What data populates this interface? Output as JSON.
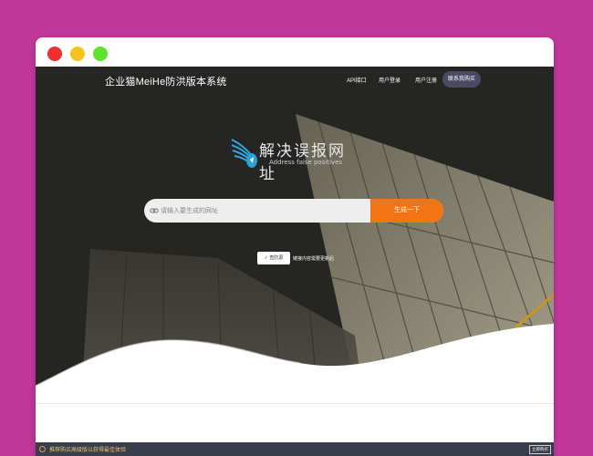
{
  "window": {
    "controls": [
      "close",
      "minimize",
      "maximize"
    ]
  },
  "header": {
    "brand": "企业猫MeiHe防洪版本系统",
    "nav": {
      "api": "API接口",
      "login": "用户登录",
      "register": "用户注册",
      "contact": "联系我购买"
    }
  },
  "logo": {
    "title": "解决误报网址",
    "subtitle": "Address false positives"
  },
  "search": {
    "placeholder": "请输入要生成的网址",
    "icon": "link-icon",
    "submit_label": "生成一下"
  },
  "options": {
    "checkbox_label": "✓ 查防源",
    "note": "链接内容需要更新后"
  },
  "promo": {
    "icon": "info-icon",
    "text": "推荐购买高级版以获得最佳体验",
    "button_label": "立即购买"
  },
  "colors": {
    "page_background": "#c0379a",
    "accent": "#f47312",
    "hero_background": "#262624",
    "promo_background": "#3a3e4c",
    "promo_text": "#e6c46c"
  }
}
